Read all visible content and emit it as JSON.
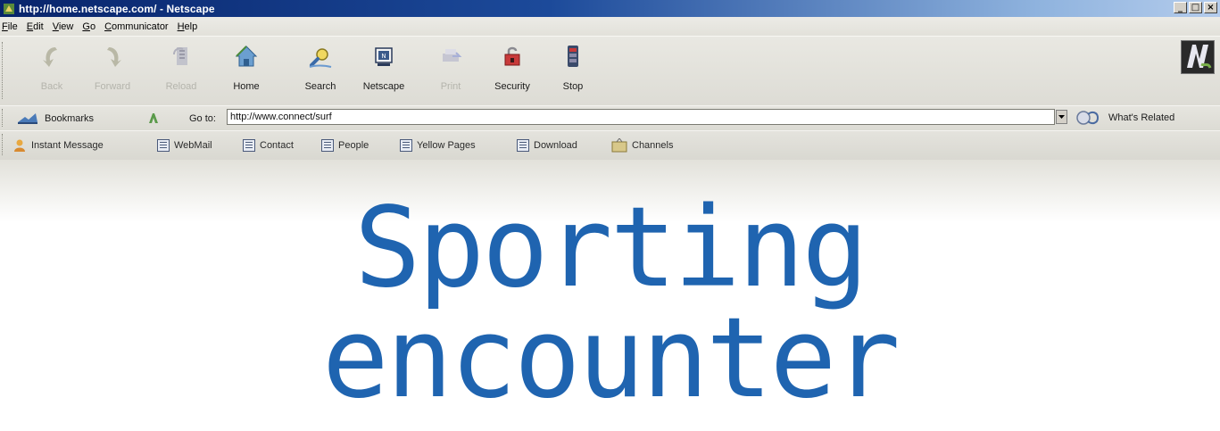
{
  "window": {
    "title": "http://home.netscape.com/ - Netscape",
    "app_icon": "netscape-page-icon",
    "controls": [
      "_",
      "□",
      "×"
    ]
  },
  "menubar": {
    "items": [
      "File",
      "Edit",
      "View",
      "Go",
      "Communicator",
      "Help"
    ]
  },
  "nav_toolbar": {
    "buttons": [
      {
        "label": "Back",
        "icon": "back-arrow-icon",
        "enabled": false
      },
      {
        "label": "Forward",
        "icon": "forward-arrow-icon",
        "enabled": false
      },
      {
        "label": "Reload",
        "icon": "reload-icon",
        "enabled": false
      },
      {
        "label": "Home",
        "icon": "home-icon",
        "enabled": true
      },
      {
        "label": "Search",
        "icon": "search-icon",
        "enabled": true
      },
      {
        "label": "Netscape",
        "icon": "netscape-icon",
        "enabled": true
      },
      {
        "label": "Print",
        "icon": "print-icon",
        "enabled": false
      },
      {
        "label": "Security",
        "icon": "security-lock-icon",
        "enabled": true
      },
      {
        "label": "Stop",
        "icon": "stop-icon",
        "enabled": true
      }
    ],
    "throbber_icon": "netscape-n-logo"
  },
  "location_bar": {
    "bookmarks_label": "Bookmarks",
    "goto_label": "Go to:",
    "url": "http://www.connect/surf",
    "related_label": "What's Related"
  },
  "personal_toolbar": {
    "items": [
      "Instant Message",
      "WebMail",
      "Contact",
      "People",
      "Yellow Pages",
      "Download",
      "Channels"
    ]
  },
  "headline": {
    "line1": "Sporting",
    "line2": "encounter",
    "color": "#1f64b0"
  }
}
